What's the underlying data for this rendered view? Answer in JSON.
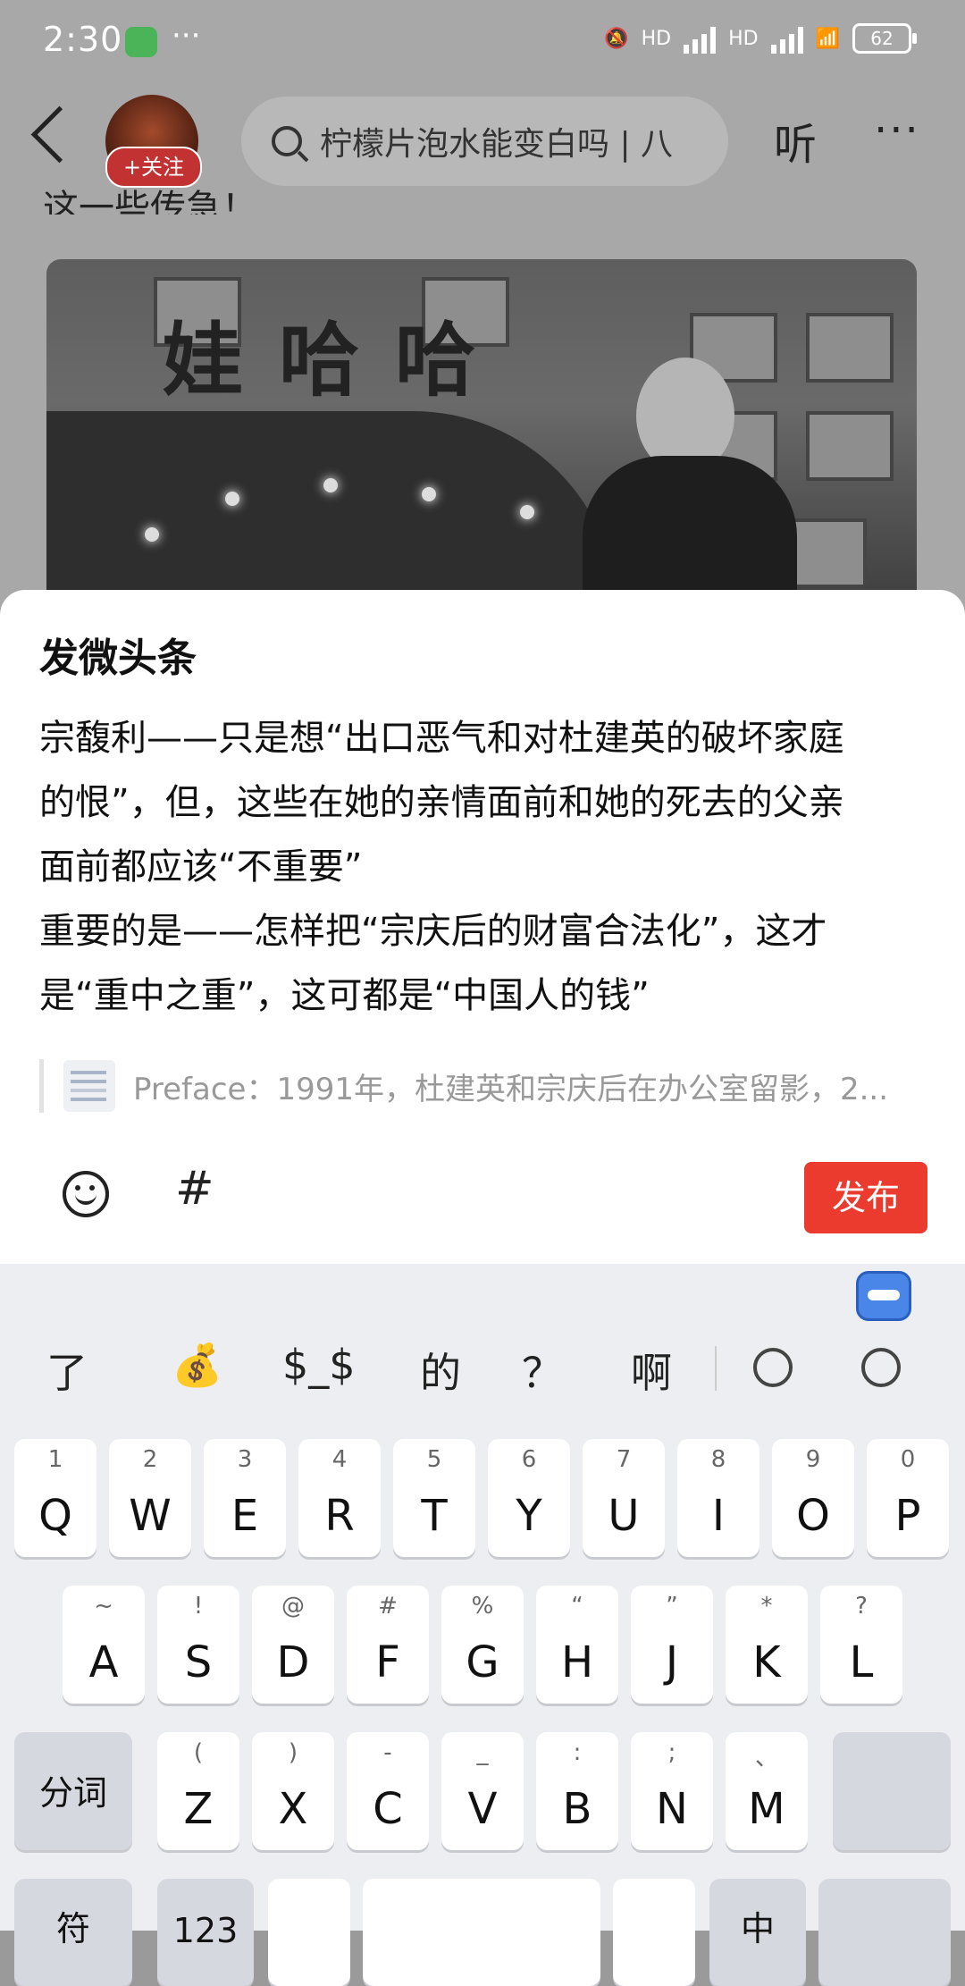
{
  "status": {
    "time": "2:30",
    "battery": "62",
    "hd1": "HD",
    "hd2": "HD",
    "more": "···"
  },
  "nav": {
    "follow_label": "+关注",
    "search_text": "柠檬片泡水能变白吗 | 八",
    "listen_label": "听",
    "more_label": "···"
  },
  "article": {
    "partial_line": "这一些传急！",
    "photo_sign": "娃哈哈"
  },
  "sheet": {
    "title": "发微头条",
    "body_lines": [
      "宗馥利——只是想“出口恶气和对杜建英的破坏家庭",
      "的恨”，但，这些在她的亲情面前和她的死去的父亲",
      "面前都应该“不重要”",
      "重要的是——怎样把“宗庆后的财富合法化”，这才",
      "是“重中之重”，这可都是“中国人的钱”"
    ],
    "quote_text": "Preface：1991年，杜建英和宗庆后在办公室留影，2...",
    "hash_label": "#",
    "publish_label": "发布"
  },
  "keyboard": {
    "candidates": [
      "了",
      "💰",
      "$_$",
      "的",
      "？",
      "啊"
    ],
    "row1": [
      {
        "k": "Q",
        "s": "1"
      },
      {
        "k": "W",
        "s": "2"
      },
      {
        "k": "E",
        "s": "3"
      },
      {
        "k": "R",
        "s": "4"
      },
      {
        "k": "T",
        "s": "5"
      },
      {
        "k": "Y",
        "s": "6"
      },
      {
        "k": "U",
        "s": "7"
      },
      {
        "k": "I",
        "s": "8"
      },
      {
        "k": "O",
        "s": "9"
      },
      {
        "k": "P",
        "s": "0"
      }
    ],
    "row2": [
      {
        "k": "A",
        "s": "~"
      },
      {
        "k": "S",
        "s": "!"
      },
      {
        "k": "D",
        "s": "@"
      },
      {
        "k": "F",
        "s": "#"
      },
      {
        "k": "G",
        "s": "%"
      },
      {
        "k": "H",
        "s": "“"
      },
      {
        "k": "J",
        "s": "”"
      },
      {
        "k": "K",
        "s": "*"
      },
      {
        "k": "L",
        "s": "?"
      }
    ],
    "row3": [
      {
        "k": "Z",
        "s": "("
      },
      {
        "k": "X",
        "s": ")"
      },
      {
        "k": "C",
        "s": "-"
      },
      {
        "k": "V",
        "s": "_"
      },
      {
        "k": "B",
        "s": ":"
      },
      {
        "k": "N",
        "s": ";"
      },
      {
        "k": "M",
        "s": "、"
      }
    ],
    "split_label": "分词",
    "row4": [
      "符",
      "123",
      "",
      "",
      "",
      "中",
      ""
    ]
  }
}
